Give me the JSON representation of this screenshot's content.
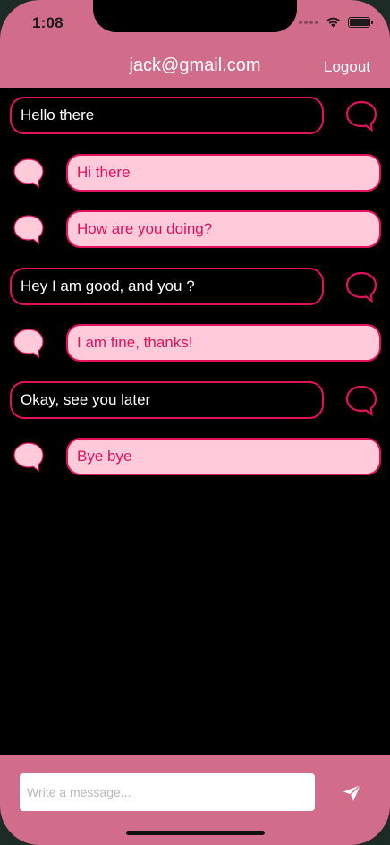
{
  "status_bar": {
    "time": "1:08"
  },
  "header": {
    "title": "jack@gmail.com",
    "logout_label": "Logout"
  },
  "messages": [
    {
      "text": "Hello there",
      "from": "me"
    },
    {
      "text": "Hi there",
      "from": "other"
    },
    {
      "text": "How are you doing?",
      "from": "other"
    },
    {
      "text": "Hey I am good, and you ?",
      "from": "me"
    },
    {
      "text": "I am fine, thanks!",
      "from": "other"
    },
    {
      "text": "Okay, see you later",
      "from": "me"
    },
    {
      "text": "Bye bye",
      "from": "other"
    }
  ],
  "composer": {
    "placeholder": "Write a message...",
    "value": ""
  },
  "colors": {
    "accent": "#d16d8b",
    "bubble_border": "#e0125e",
    "received_bg": "#ffcad9",
    "icon_fill": "#ffcad9"
  },
  "icons": {
    "sent_avatar": "chat-bubble-outline-icon",
    "received_avatar": "chat-bubble-filled-icon",
    "send": "send-icon"
  }
}
